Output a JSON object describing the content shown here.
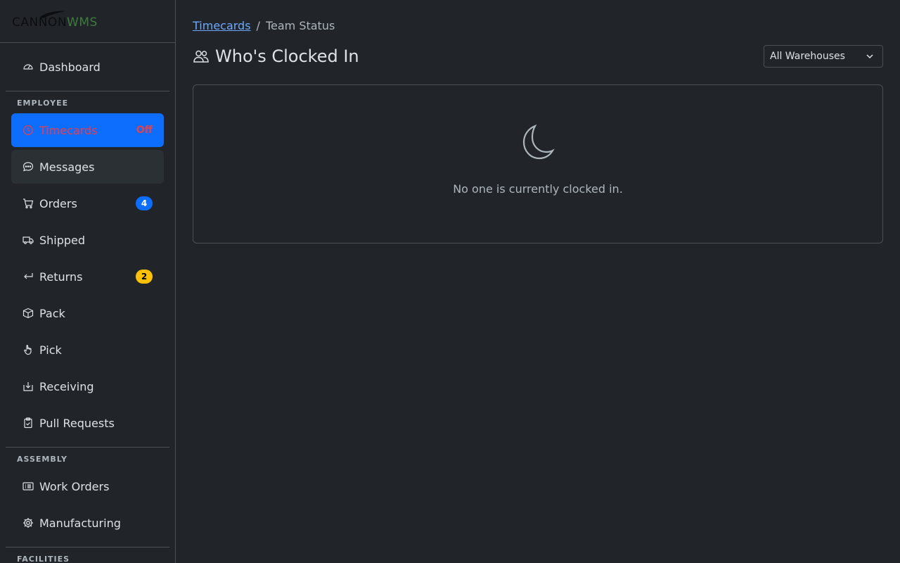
{
  "logo": {
    "part1": "CANNON",
    "part2": "WMS"
  },
  "sidebar": {
    "dashboard": {
      "label": "Dashboard",
      "icon": "speedometer-icon"
    },
    "sections": [
      {
        "label": "EMPLOYEE",
        "items": [
          {
            "label": "Timecards",
            "icon": "clock-icon",
            "status": "Off",
            "state": "active"
          },
          {
            "label": "Messages",
            "icon": "chat-icon",
            "state": "hover"
          },
          {
            "label": "Orders",
            "icon": "cart-icon",
            "badge": "4",
            "badge_color": "#0d6efd"
          },
          {
            "label": "Shipped",
            "icon": "truck-icon"
          },
          {
            "label": "Returns",
            "icon": "return-arrow-icon",
            "badge": "2",
            "badge_color": "#ffc107"
          },
          {
            "label": "Pack",
            "icon": "box-icon"
          },
          {
            "label": "Pick",
            "icon": "hand-pointer-icon"
          },
          {
            "label": "Receiving",
            "icon": "inbox-download-icon"
          },
          {
            "label": "Pull Requests",
            "icon": "clipboard-check-icon"
          }
        ]
      },
      {
        "label": "ASSEMBLY",
        "items": [
          {
            "label": "Work Orders",
            "icon": "list-card-icon"
          },
          {
            "label": "Manufacturing",
            "icon": "gear-icon"
          }
        ]
      },
      {
        "label": "FACILITIES",
        "items": []
      }
    ]
  },
  "breadcrumb": {
    "parent": "Timecards",
    "separator": "/",
    "current": "Team Status"
  },
  "page": {
    "title": "Who's Clocked In",
    "icon": "people-icon"
  },
  "warehouse_select": {
    "selected": "All Warehouses"
  },
  "empty_state": {
    "icon": "moon-icon",
    "message": "No one is currently clocked in."
  },
  "colors": {
    "accent": "#0d6efd",
    "danger": "#e0424f",
    "warning": "#ffc107",
    "background": "#212529",
    "border": "#495057"
  }
}
